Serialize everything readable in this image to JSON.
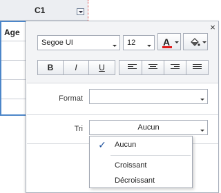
{
  "grid": {
    "column_title": "C1",
    "age_header": "Age"
  },
  "toolbar": {
    "font_family": "Segoe UI",
    "font_size": "12",
    "font_color_label": "A",
    "bold": "B",
    "italic": "I",
    "underline": "U",
    "icons": {
      "font_color": "font-color-icon",
      "fill_color": "paint-bucket-icon",
      "align_left": "align-left-icon",
      "align_center": "align-center-icon",
      "align_right": "align-right-icon",
      "justify": "align-justify-icon",
      "close": "close-icon"
    },
    "colors": {
      "font_color_underline": "#e01b1b",
      "selection_border": "#4c86c9"
    }
  },
  "form": {
    "format_label": "Format",
    "format_value": "",
    "sort_label": "Tri",
    "sort_value": "Aucun"
  },
  "sort_options": [
    {
      "label": "Aucun",
      "selected": true
    },
    {
      "label": "Croissant",
      "selected": false
    },
    {
      "label": "Décroissant",
      "selected": false
    }
  ]
}
